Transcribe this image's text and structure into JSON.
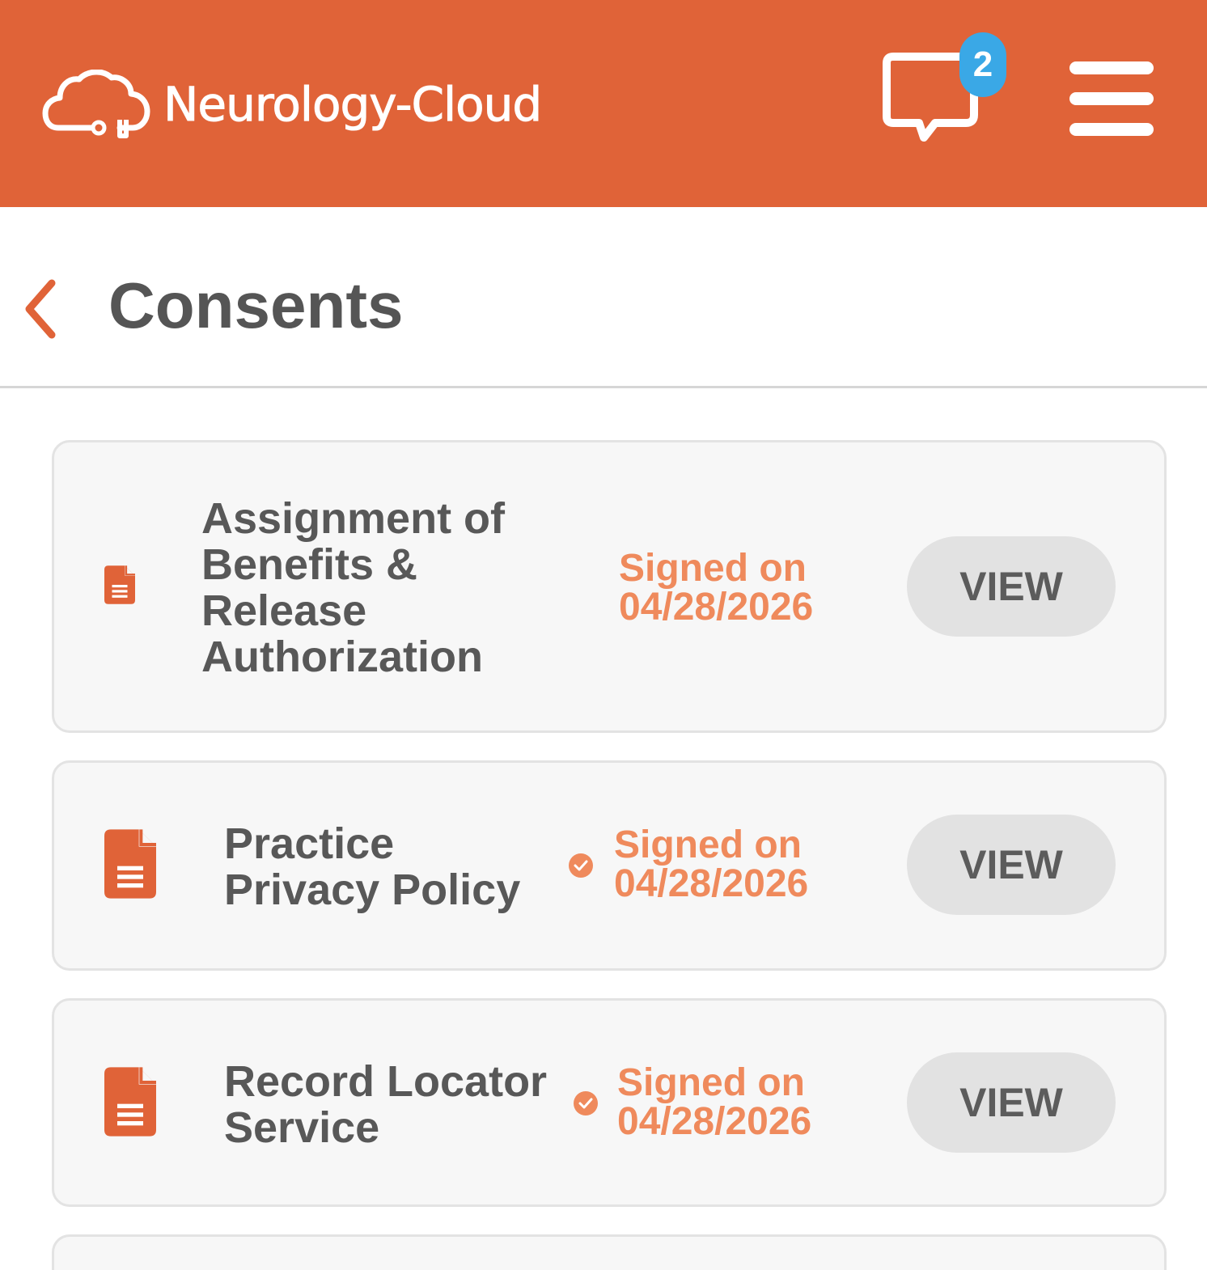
{
  "header": {
    "app_name": "Neurology-Cloud",
    "message_badge_count": "2",
    "logo_icon": "cloud-icon",
    "messages_icon": "chat-bubble-icon",
    "menu_icon": "hamburger-menu-icon",
    "colors": {
      "brand": "#e06338",
      "badge": "#3aa8e6"
    }
  },
  "page": {
    "title": "Consents",
    "back_icon": "chevron-left-icon"
  },
  "consents": [
    {
      "title_lines": [
        "Assignment of",
        "Benefits &",
        "Release",
        "Authorization"
      ],
      "signed_label": "Signed on",
      "signed_date": "04/28/2026",
      "view_label": "VIEW",
      "icon": "document-icon"
    },
    {
      "title_lines": [
        "Practice",
        "Privacy Policy"
      ],
      "signed_label": "Signed on",
      "signed_date": "04/28/2026",
      "view_label": "VIEW",
      "icon": "document-icon",
      "status_icon": "check-circle-icon"
    },
    {
      "title_lines": [
        "Record Locator",
        "Service"
      ],
      "signed_label": "Signed on",
      "signed_date": "04/28/2026",
      "view_label": "VIEW",
      "icon": "document-icon",
      "status_icon": "check-circle-icon"
    }
  ],
  "colors": {
    "signed_text": "#ef8a5c",
    "view_button": "#e2e2e2"
  }
}
